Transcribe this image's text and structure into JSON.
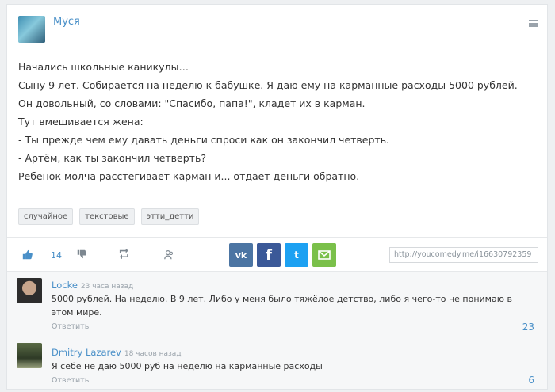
{
  "post": {
    "author": "Муся",
    "lines": [
      "Начались школьные каникулы…",
      "Сыну 9 лет. Собирается на неделю к бабушке. Я даю ему на карманные расходы 5000 рублей. Он довольный, со словами: \"Спасибо, папа!\", кладет их в карман.",
      "Тут вмешивается жена:",
      "- Ты прежде чем ему давать деньги спроси как он закончил четверть.",
      "- Артём, как ты закончил четверть?",
      "Ребенок молча расстегивает карман и... отдает деньги обратно."
    ],
    "tags": [
      "случайное",
      "текстовые",
      "этти_детти"
    ]
  },
  "actions": {
    "likes": "14",
    "share_vk": "vk",
    "share_fb": "f",
    "share_tw": "t",
    "link_value": "http://youcomedy.me/i16630792359",
    "icons": [
      "thumbs-up-icon",
      "thumbs-down-icon",
      "repost-icon",
      "group-icon",
      "vk-icon",
      "facebook-icon",
      "twitter-icon",
      "email-icon"
    ]
  },
  "comments": [
    {
      "name": "Locke",
      "time": "23 часа назад",
      "text": "5000 рублей. На неделю. В 9 лет. Либо у меня было тяжёлое детство, либо я чего-то не понимаю в этом мире.",
      "reply": "Ответить",
      "count": "23"
    },
    {
      "name": "Dmitry Lazarev",
      "time": "18 часов назад",
      "text": "Я себе не даю 5000 руб на неделю на карманные расходы",
      "reply": "Ответить",
      "count": "6"
    }
  ],
  "colors": {
    "accent": "#4a90c8",
    "vk": "#4c75a3",
    "facebook": "#3b5998",
    "twitter": "#1da1f2",
    "email": "#7ac04a"
  }
}
